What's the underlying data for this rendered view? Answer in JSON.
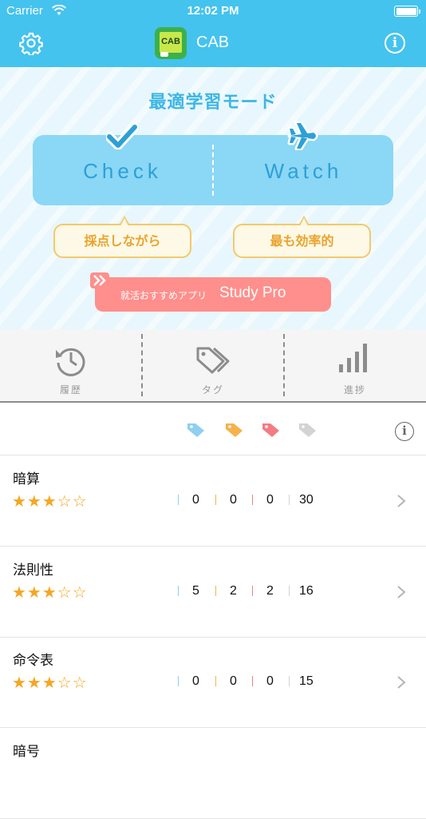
{
  "status_bar": {
    "carrier": "Carrier",
    "time": "12:02 PM"
  },
  "nav": {
    "title": "CAB",
    "logo_text": "CAB"
  },
  "hero": {
    "title": "最適学習モード",
    "check_label": "Check",
    "watch_label": "Watch",
    "check_caption": "採点しながら",
    "watch_caption": "最も効率的",
    "promo_sub": "就活おすすめアプリ",
    "promo_main": "Study Pro"
  },
  "tabs": [
    {
      "label": "履歴",
      "icon": "history-icon"
    },
    {
      "label": "タグ",
      "icon": "tag-icon"
    },
    {
      "label": "進捗",
      "icon": "progress-bars-icon"
    }
  ],
  "tag_colors": [
    "#8fcff2",
    "#f6b24a",
    "#f47c84",
    "#d3d3d3"
  ],
  "rows": [
    {
      "name": "暗算",
      "rating": 3,
      "blue": "0",
      "orange": "0",
      "red": "0",
      "total": "30"
    },
    {
      "name": "法則性",
      "rating": 3,
      "blue": "5",
      "orange": "2",
      "red": "2",
      "total": "16"
    },
    {
      "name": "命令表",
      "rating": 3,
      "blue": "0",
      "orange": "0",
      "red": "0",
      "total": "15"
    },
    {
      "name": "暗号",
      "rating": null,
      "blue": "",
      "orange": "",
      "red": "",
      "total": ""
    }
  ]
}
